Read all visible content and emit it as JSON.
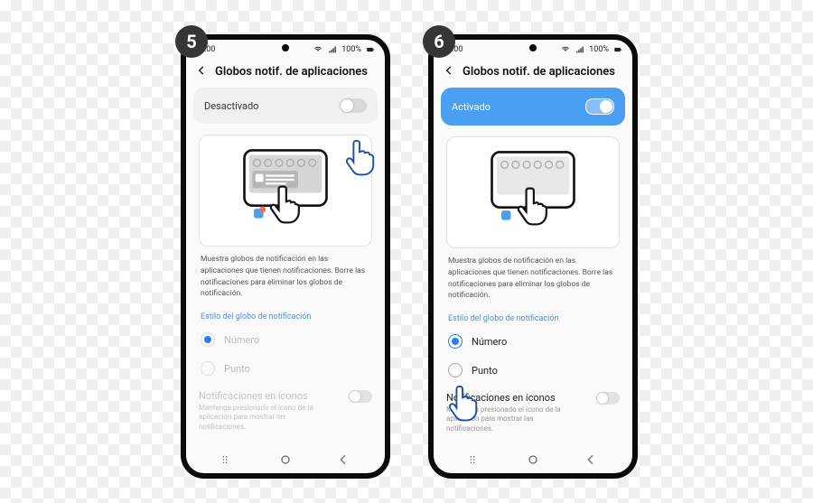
{
  "steps": {
    "s5": {
      "badge": "5"
    },
    "s6": {
      "badge": "6"
    }
  },
  "status": {
    "time": "10:00",
    "net": "100%"
  },
  "header": {
    "title": "Globos notif. de aplicaciones"
  },
  "toggle": {
    "off_label": "Desactivado",
    "on_label": "Activado"
  },
  "description": "Muestra globos de notificación en las aplicaciones que tienen notificaciones. Borre las notificaciones para eliminar los globos de notificación.",
  "style_section": "Estilo del globo de notificación",
  "options": {
    "number": "Número",
    "dot": "Punto"
  },
  "icon_notif": {
    "title": "Notificaciones en íconos",
    "sub": "Mantenga presionado el ícono de la aplicación para mostrar las notificaciones."
  }
}
